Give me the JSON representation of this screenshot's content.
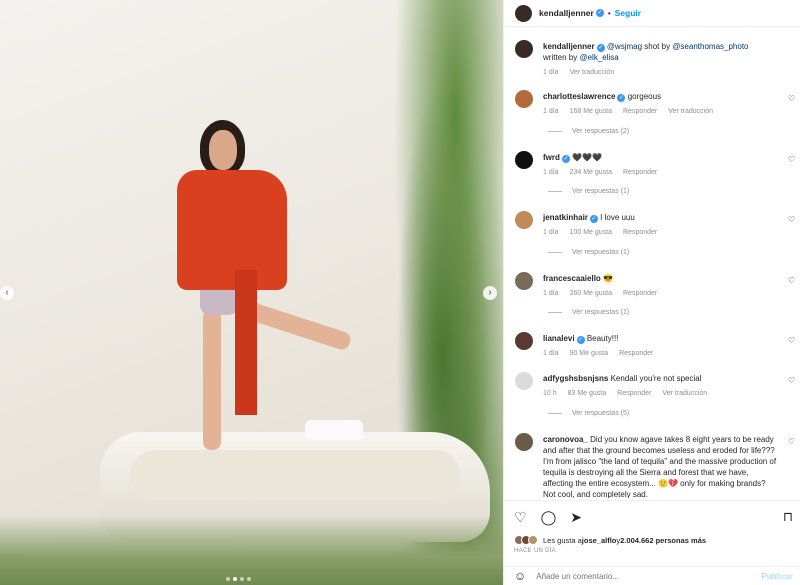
{
  "post": {
    "author": "kendalljenner",
    "follow_label": "Seguir",
    "caption": {
      "mention_1": "@wsjmag",
      "text_1": " shot by ",
      "mention_2": "@seanthomas_photo",
      "text_2": "written by ",
      "mention_3": "@elk_elisa",
      "time": "1 día",
      "translate": "Ver traducción"
    }
  },
  "comments": [
    {
      "user": "charlotteslawrence",
      "verified": true,
      "text": "gorgeous",
      "time": "1 día",
      "likes": "168 Me gusta",
      "reply": "Responder",
      "translate": "Ver traducción",
      "replies": "Ver respuestas (2)",
      "avatar_color": "#b36a3c"
    },
    {
      "user": "fwrd",
      "verified": true,
      "text": "🖤🖤🖤",
      "time": "1 día",
      "likes": "234 Me gusta",
      "reply": "Responder",
      "translate": "",
      "replies": "Ver respuestas (1)",
      "avatar_color": "#111111"
    },
    {
      "user": "jenatkinhair",
      "verified": true,
      "text": "I love uuu",
      "time": "1 día",
      "likes": "100 Me gusta",
      "reply": "Responder",
      "translate": "",
      "replies": "Ver respuestas (1)",
      "avatar_color": "#c08a5a"
    },
    {
      "user": "francescaaiello",
      "verified": false,
      "text": "😎",
      "time": "1 día",
      "likes": "260 Me gusta",
      "reply": "Responder",
      "translate": "",
      "replies": "Ver respuestas (1)",
      "avatar_color": "#7a6a5a"
    },
    {
      "user": "lianalevi",
      "verified": true,
      "text": "Beauty!!!",
      "time": "1 día",
      "likes": "90 Me gusta",
      "reply": "Responder",
      "translate": "",
      "replies": "",
      "avatar_color": "#5a3a30"
    },
    {
      "user": "adfygshsbsnjsns",
      "verified": false,
      "text": "Kendall you're not special",
      "time": "10 h",
      "likes": "83 Me gusta",
      "reply": "Responder",
      "translate": "Ver traducción",
      "replies": "Ver respuestas (5)",
      "avatar_color": "#dbdbdb"
    },
    {
      "user": "caronovoa_",
      "verified": false,
      "text": "Did you know agave takes 8 eight years to be ready and after that the ground becomes useless and eroded for life??? I'm from jalisco \"the land of tequila\" and the massive production of tequila is destroying all the Sierra and forest that we have, affecting the entire ecosystem... 🙂💔 only for making brands? Not cool, and completely sad.",
      "time": "",
      "likes": "",
      "reply": "",
      "translate": "",
      "replies": "",
      "avatar_color": "#6b5a4a"
    }
  ],
  "likes_line": {
    "prefix": "Les gusta a ",
    "user": "jose_alflo",
    "middle": " y ",
    "count": "2.004.662 personas más"
  },
  "posted_ago": "HACE UN DÍA",
  "composer": {
    "placeholder": "Añade un comentario...",
    "publish": "Publicar"
  },
  "icons": {
    "like": "heart-icon",
    "comment": "comment-icon",
    "share": "share-icon",
    "save": "bookmark-icon",
    "emoji": "emoji-icon"
  },
  "colors": {
    "link": "#00376b",
    "verified": "#3897f0",
    "follow": "#0095f6"
  }
}
